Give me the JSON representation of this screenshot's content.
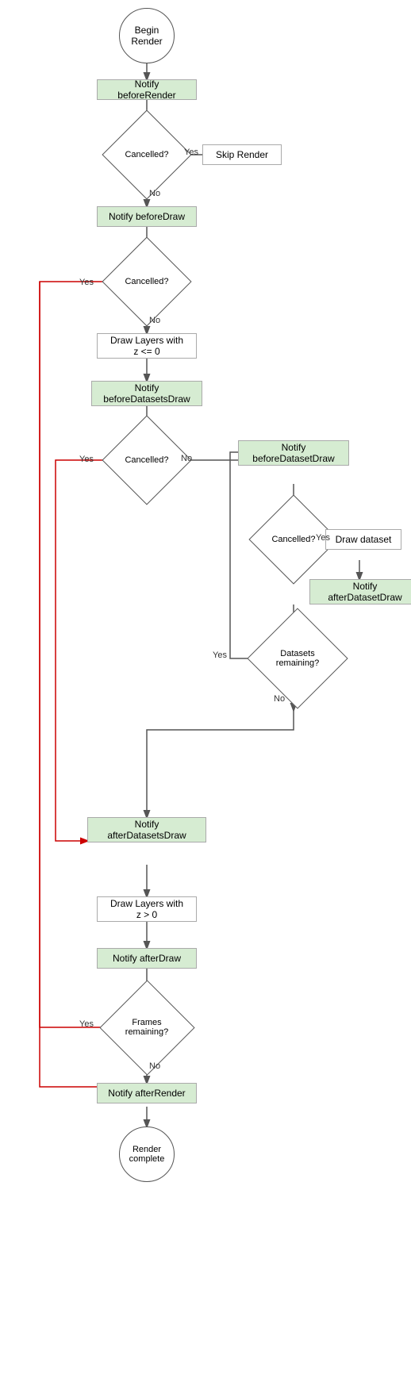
{
  "nodes": {
    "begin_render": {
      "label": "Begin Render"
    },
    "notify_before_render": {
      "label": "Notify beforeRender"
    },
    "cancelled_1": {
      "label": "Cancelled?"
    },
    "skip_render": {
      "label": "Skip Render"
    },
    "notify_before_draw": {
      "label": "Notify beforeDraw"
    },
    "cancelled_2": {
      "label": "Cancelled?"
    },
    "draw_layers_z0": {
      "label": "Draw Layers with\nz <= 0"
    },
    "notify_before_datasets_draw": {
      "label": "Notify\nbeforeDatasetsDraw"
    },
    "cancelled_3": {
      "label": "Cancelled?"
    },
    "notify_before_dataset_draw": {
      "label": "Notify\nbeforeDatasetDraw"
    },
    "cancelled_4": {
      "label": "Cancelled?"
    },
    "draw_dataset": {
      "label": "Draw dataset"
    },
    "notify_after_dataset_draw": {
      "label": "Notify\nafterDatasetDraw"
    },
    "datasets_remaining": {
      "label": "Datasets\nremaining?"
    },
    "notify_after_datasets_draw": {
      "label": "Notify\nafterDatasetsDraw"
    },
    "draw_layers_zpos": {
      "label": "Draw Layers with\nz > 0"
    },
    "notify_after_draw": {
      "label": "Notify afterDraw"
    },
    "frames_remaining": {
      "label": "Frames\nremaining?"
    },
    "notify_after_render": {
      "label": "Notify afterRender"
    },
    "render_complete": {
      "label": "Render\ncomplete"
    }
  },
  "labels": {
    "yes": "Yes",
    "no": "No"
  }
}
